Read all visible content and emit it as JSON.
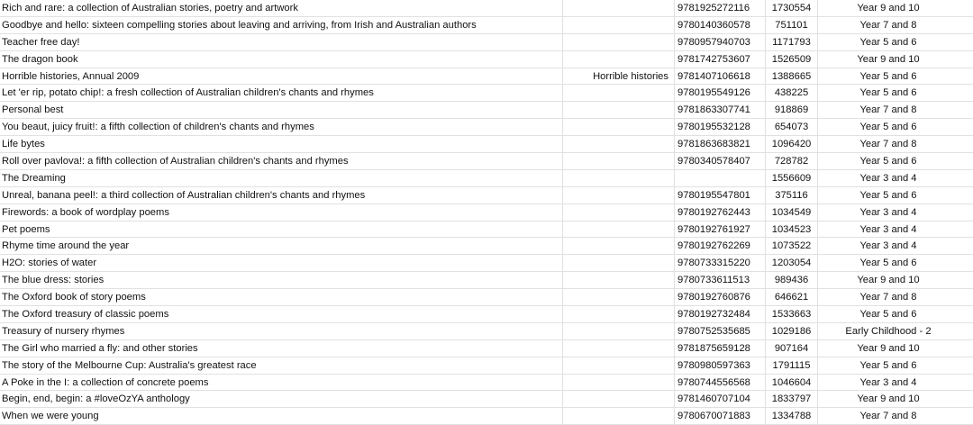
{
  "table": {
    "rows": [
      {
        "title": "Rich and rare: a collection of Australian stories, poetry and artwork",
        "series": "",
        "isbn": "9781925272116",
        "id": "1730554",
        "level": "Year 9 and 10"
      },
      {
        "title": "Goodbye and hello: sixteen compelling stories about leaving and arriving, from Irish and Australian authors",
        "series": "",
        "isbn": "9780140360578",
        "id": "751101",
        "level": "Year 7 and 8"
      },
      {
        "title": "Teacher free day!",
        "series": "",
        "isbn": "9780957940703",
        "id": "1171793",
        "level": "Year 5 and 6"
      },
      {
        "title": "The dragon book",
        "series": "",
        "isbn": "9781742753607",
        "id": "1526509",
        "level": "Year 9 and 10"
      },
      {
        "title": "Horrible histories, Annual 2009",
        "series": "Horrible histories",
        "isbn": "9781407106618",
        "id": "1388665",
        "level": "Year 5 and 6"
      },
      {
        "title": "Let 'er rip, potato chip!: a fresh collection of Australian children's chants and rhymes",
        "series": "",
        "isbn": "9780195549126",
        "id": "438225",
        "level": "Year 5 and 6"
      },
      {
        "title": "Personal best",
        "series": "",
        "isbn": "9781863307741",
        "id": "918869",
        "level": "Year 7 and 8"
      },
      {
        "title": "You beaut, juicy fruit!: a fifth collection of children's chants and rhymes",
        "series": "",
        "isbn": "9780195532128",
        "id": "654073",
        "level": "Year 5 and 6"
      },
      {
        "title": "Life bytes",
        "series": "",
        "isbn": "9781863683821",
        "id": "1096420",
        "level": "Year 7 and 8"
      },
      {
        "title": "Roll over pavlova!: a fifth collection of Australian children's chants and rhymes",
        "series": "",
        "isbn": "9780340578407",
        "id": "728782",
        "level": "Year 5 and 6"
      },
      {
        "title": "The Dreaming",
        "series": "",
        "isbn": "",
        "id": "1556609",
        "level": "Year 3 and 4"
      },
      {
        "title": "Unreal, banana peel!: a third collection of Australian children's chants and rhymes",
        "series": "",
        "isbn": "9780195547801",
        "id": "375116",
        "level": "Year 5 and 6"
      },
      {
        "title": "Firewords: a book of wordplay poems",
        "series": "",
        "isbn": "9780192762443",
        "id": "1034549",
        "level": "Year 3 and 4"
      },
      {
        "title": "Pet poems",
        "series": "",
        "isbn": "9780192761927",
        "id": "1034523",
        "level": "Year 3 and 4"
      },
      {
        "title": "Rhyme time around the year",
        "series": "",
        "isbn": "9780192762269",
        "id": "1073522",
        "level": "Year 3 and 4"
      },
      {
        "title": "H2O: stories of water",
        "series": "",
        "isbn": "9780733315220",
        "id": "1203054",
        "level": "Year 5 and 6"
      },
      {
        "title": "The blue dress: stories",
        "series": "",
        "isbn": "9780733611513",
        "id": "989436",
        "level": "Year 9 and 10"
      },
      {
        "title": "The Oxford book of story poems",
        "series": "",
        "isbn": "9780192760876",
        "id": "646621",
        "level": "Year 7 and 8"
      },
      {
        "title": "The Oxford treasury of classic poems",
        "series": "",
        "isbn": "9780192732484",
        "id": "1533663",
        "level": "Year 5 and 6"
      },
      {
        "title": "Treasury of nursery rhymes",
        "series": "",
        "isbn": "9780752535685",
        "id": "1029186",
        "level": "Early Childhood - 2"
      },
      {
        "title": "The Girl who married a fly: and other stories",
        "series": "",
        "isbn": "9781875659128",
        "id": "907164",
        "level": "Year 9 and 10"
      },
      {
        "title": "The story of the Melbourne Cup: Australia's greatest race",
        "series": "",
        "isbn": "9780980597363",
        "id": "1791115",
        "level": "Year 5 and 6"
      },
      {
        "title": "A Poke in the I: a collection of concrete poems",
        "series": "",
        "isbn": "9780744556568",
        "id": "1046604",
        "level": "Year 3 and 4"
      },
      {
        "title": "Begin, end, begin: a #loveOzYA anthology",
        "series": "",
        "isbn": "9781460707104",
        "id": "1833797",
        "level": "Year 9 and 10"
      },
      {
        "title": "When we were young",
        "series": "",
        "isbn": "9780670071883",
        "id": "1334788",
        "level": "Year 7 and 8"
      }
    ]
  }
}
